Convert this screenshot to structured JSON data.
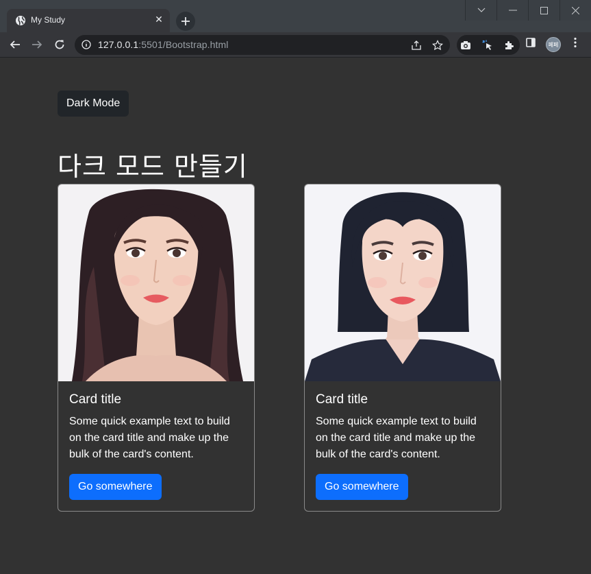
{
  "browser": {
    "tab_title": "My Study",
    "url_host": "127.0.0.1",
    "url_path": ":5501/Bootstrap.html",
    "avatar_text": "페페"
  },
  "page": {
    "dark_mode_button": "Dark Mode",
    "heading": "다크 모드 만들기",
    "cards": [
      {
        "image": "portrait-long-hair",
        "title": "Card title",
        "text": "Some quick example text to build on the card title and make up the bulk of the card's content.",
        "button": "Go somewhere"
      },
      {
        "image": "portrait-short-hair",
        "title": "Card title",
        "text": "Some quick example text to build on the card title and make up the bulk of the card's content.",
        "button": "Go somewhere"
      }
    ]
  },
  "colors": {
    "page_bg": "#323232",
    "primary_button": "#0d6efd",
    "dark_button": "#212529"
  }
}
